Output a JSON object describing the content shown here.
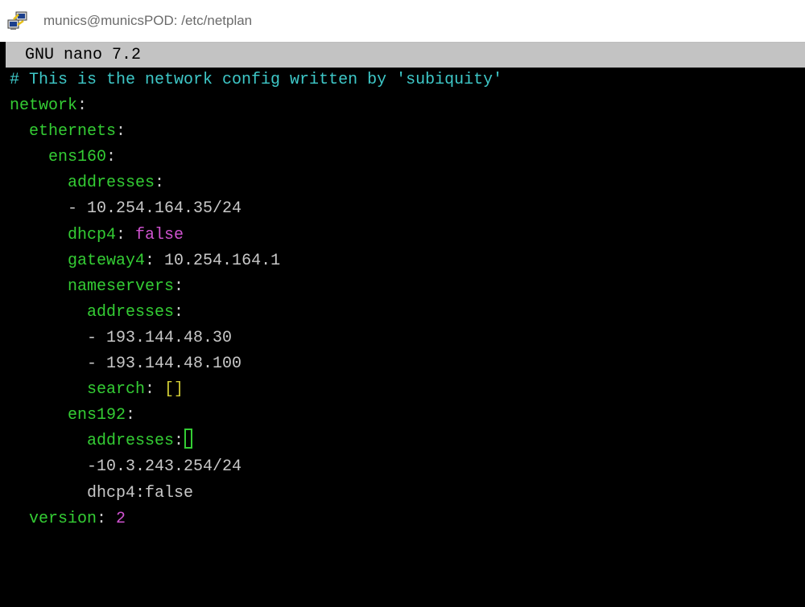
{
  "window": {
    "title": "munics@municsPOD: /etc/netplan",
    "icon": "putty-icon"
  },
  "nano": {
    "version_label": "GNU nano 7.2"
  },
  "editor": {
    "lines": [
      {
        "indent": "",
        "parts": [
          {
            "text": "# This is the network config written by 'subiquity'",
            "kind": "comment"
          }
        ]
      },
      {
        "indent": "",
        "parts": [
          {
            "text": "network",
            "kind": "key"
          },
          {
            "text": ":",
            "kind": "white"
          }
        ]
      },
      {
        "indent": "  ",
        "parts": [
          {
            "text": "ethernets",
            "kind": "key"
          },
          {
            "text": ":",
            "kind": "white"
          }
        ]
      },
      {
        "indent": "    ",
        "parts": [
          {
            "text": "ens160",
            "kind": "key"
          },
          {
            "text": ":",
            "kind": "white"
          }
        ]
      },
      {
        "indent": "      ",
        "parts": [
          {
            "text": "addresses",
            "kind": "key"
          },
          {
            "text": ":",
            "kind": "white"
          }
        ]
      },
      {
        "indent": "      ",
        "parts": [
          {
            "text": "- 10.254.164.35/24",
            "kind": "val"
          }
        ]
      },
      {
        "indent": "      ",
        "parts": [
          {
            "text": "dhcp4",
            "kind": "key"
          },
          {
            "text": ": ",
            "kind": "white"
          },
          {
            "text": "false",
            "kind": "pink"
          }
        ]
      },
      {
        "indent": "      ",
        "parts": [
          {
            "text": "gateway4",
            "kind": "key"
          },
          {
            "text": ": ",
            "kind": "white"
          },
          {
            "text": "10.254.164.1",
            "kind": "val"
          }
        ]
      },
      {
        "indent": "      ",
        "parts": [
          {
            "text": "nameservers",
            "kind": "key"
          },
          {
            "text": ":",
            "kind": "white"
          }
        ]
      },
      {
        "indent": "        ",
        "parts": [
          {
            "text": "addresses",
            "kind": "key"
          },
          {
            "text": ":",
            "kind": "white"
          }
        ]
      },
      {
        "indent": "        ",
        "parts": [
          {
            "text": "- 193.144.48.30",
            "kind": "val"
          }
        ]
      },
      {
        "indent": "        ",
        "parts": [
          {
            "text": "- 193.144.48.100",
            "kind": "val"
          }
        ]
      },
      {
        "indent": "        ",
        "parts": [
          {
            "text": "search",
            "kind": "key"
          },
          {
            "text": ": ",
            "kind": "white"
          },
          {
            "text": "[]",
            "kind": "yellow"
          }
        ]
      },
      {
        "indent": "      ",
        "parts": [
          {
            "text": "ens192",
            "kind": "key"
          },
          {
            "text": ":",
            "kind": "white"
          }
        ]
      },
      {
        "indent": "        ",
        "parts": [
          {
            "text": "addresses",
            "kind": "key"
          },
          {
            "text": ":",
            "kind": "white"
          }
        ],
        "cursor": true
      },
      {
        "indent": "        ",
        "parts": [
          {
            "text": "-10.3.243.254/24",
            "kind": "val"
          }
        ]
      },
      {
        "indent": "        ",
        "parts": [
          {
            "text": "dhcp4:false",
            "kind": "val"
          }
        ]
      },
      {
        "indent": "  ",
        "parts": [
          {
            "text": "version",
            "kind": "key"
          },
          {
            "text": ": ",
            "kind": "white"
          },
          {
            "text": "2",
            "kind": "pink"
          }
        ]
      }
    ]
  },
  "colors": {
    "background": "#000000",
    "comment": "#3ec8c8",
    "key": "#34cd34",
    "value": "#c8c8c8",
    "boolean_number": "#cf52cf",
    "brackets": "#d2cd35",
    "header_bar": "#c3c3c3"
  }
}
